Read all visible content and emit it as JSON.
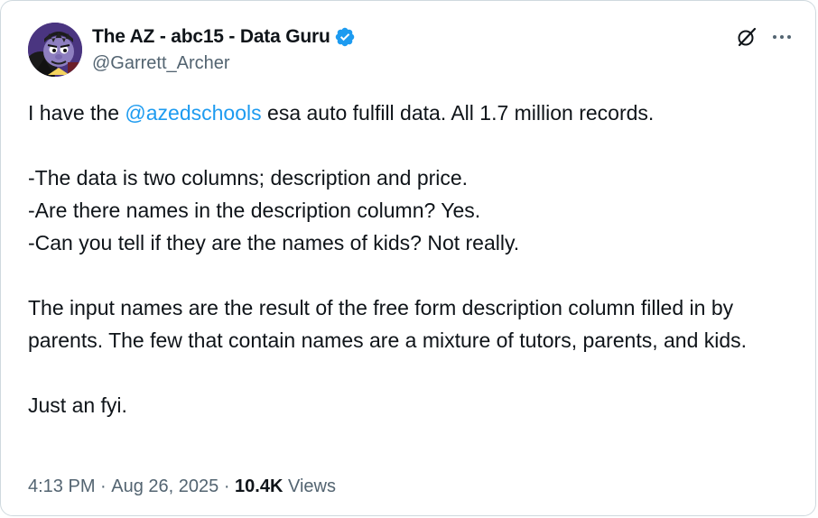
{
  "author": {
    "display_name": "The AZ - abc15 - Data Guru",
    "handle": "@Garrett_Archer",
    "verified": true,
    "verified_color": "#1d9bf0"
  },
  "header_actions": {
    "grok_icon": "grok-icon",
    "more_icon": "more-horizontal-icon"
  },
  "tweet": {
    "line1_pre": "I have the ",
    "line1_mention": "@azedschools",
    "line1_post": " esa auto fulfill data. All 1.7 million records.",
    "bullets": [
      "-The data is two columns; description and price.",
      "-Are there names in the description column? Yes.",
      "-Can you tell if they are the names of kids? Not really."
    ],
    "paragraph3": "The input names are the result of the free form description column filled in by parents. The few that contain names are a mixture of tutors, parents, and kids.",
    "paragraph4": "Just an fyi."
  },
  "meta": {
    "time": "4:13 PM",
    "sep1": " · ",
    "date": "Aug 26, 2025",
    "sep2": " · ",
    "views_count": "10.4K",
    "views_label": " Views"
  },
  "colors": {
    "text": "#0f1419",
    "secondary": "#536471",
    "link": "#1d9bf0",
    "border": "#cfd9de"
  }
}
